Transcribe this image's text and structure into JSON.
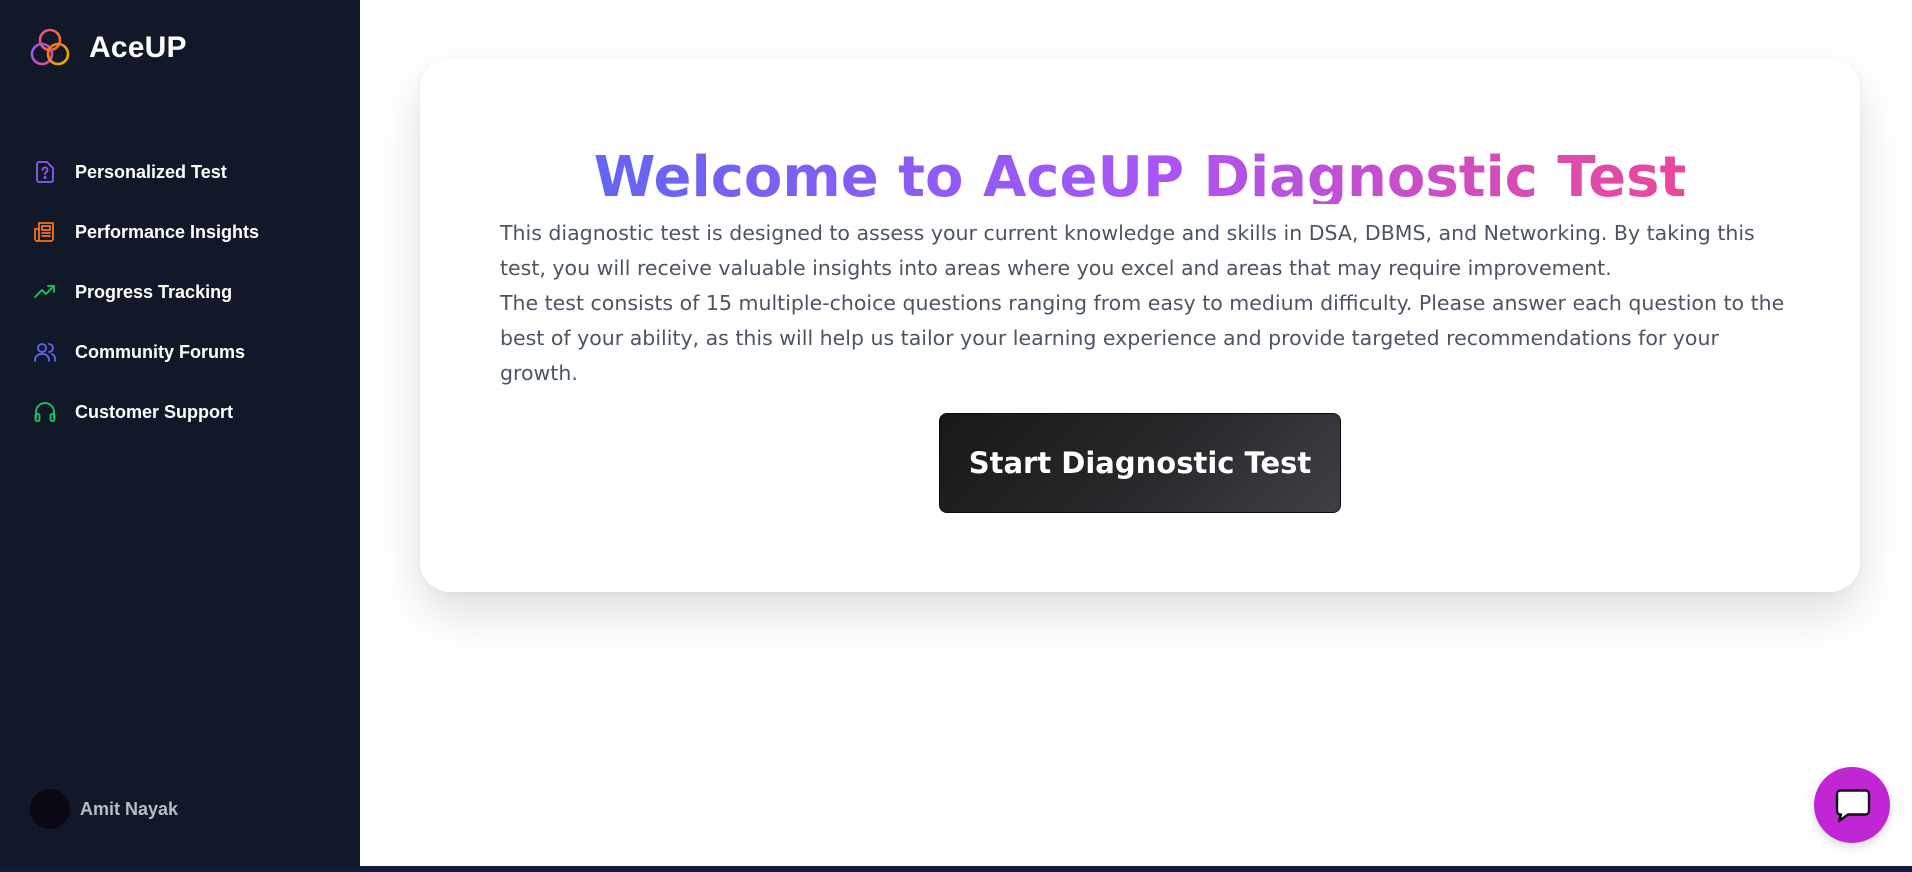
{
  "brand": {
    "name": "AceUP",
    "logo_icon": "interlocking-rings-logo"
  },
  "sidebar": {
    "items": [
      {
        "label": "Personalized Test",
        "icon": "question-document-icon",
        "color": "#8b5cf6"
      },
      {
        "label": "Performance Insights",
        "icon": "newspaper-icon",
        "color": "#f97316"
      },
      {
        "label": "Progress Tracking",
        "icon": "trending-up-icon",
        "color": "#22c55e"
      },
      {
        "label": "Community Forums",
        "icon": "users-icon",
        "color": "#6366f1"
      },
      {
        "label": "Customer Support",
        "icon": "headphones-icon",
        "color": "#22c55e"
      }
    ],
    "user": {
      "name": "Amit Nayak"
    }
  },
  "main": {
    "title": "Welcome to AceUP Diagnostic Test",
    "paragraphs": [
      "This diagnostic test is designed to assess your current knowledge and skills in DSA, DBMS, and Networking. By taking this test, you will receive valuable insights into areas where you excel and areas that may require improvement.",
      "The test consists of 15 multiple-choice questions ranging from easy to medium difficulty. Please answer each question to the best of your ability, as this will help us tailor your learning experience and provide targeted recommendations for your growth."
    ],
    "start_button_label": "Start Diagnostic Test"
  },
  "chat_widget": {
    "icon": "chat-bubble-icon",
    "color": "#c026d3"
  },
  "colors": {
    "sidebar_bg": "#111827",
    "gradient": [
      "#6366f1",
      "#a855f7",
      "#ec4899"
    ]
  }
}
